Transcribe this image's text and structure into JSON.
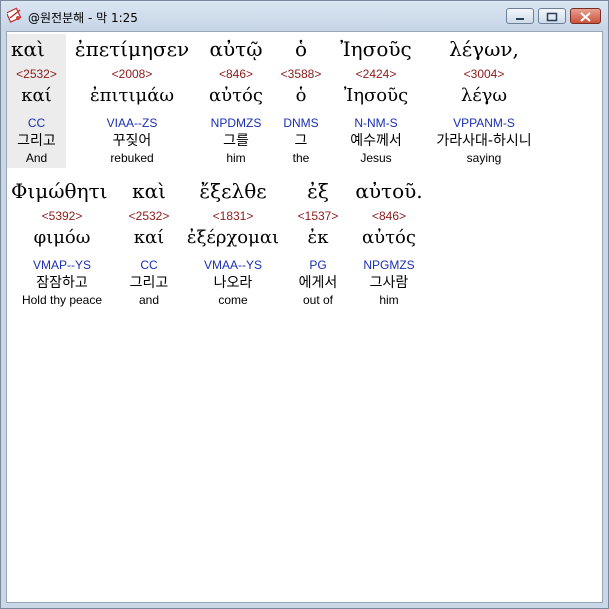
{
  "window": {
    "title": "@원전분해 - 막 1:25",
    "icon": "bible-app-icon",
    "buttons": [
      "minimize-button",
      "maximize-button",
      "close-button"
    ]
  },
  "colors": {
    "strong": "#8b1a1a",
    "parse": "#1a2fb0",
    "highlight": "#ececec"
  },
  "verse": {
    "rows": [
      {
        "words": [
          {
            "greek": "καὶ",
            "strong": "<2532>",
            "lemma": "καί",
            "parse": "CC",
            "korean": "그리고",
            "english": "And"
          },
          {
            "greek": "ἐπετίμησεν",
            "strong": "<2008>",
            "lemma": "ἐπιτιμάω",
            "parse": "VIAA--ZS",
            "korean": "꾸짖어",
            "english": "rebuked"
          },
          {
            "greek": "αὐτῷ",
            "strong": "<846>",
            "lemma": "αὐτός",
            "parse": "NPDMZS",
            "korean": "그를",
            "english": "him"
          },
          {
            "greek": "ὁ",
            "strong": "<3588>",
            "lemma": "ὁ",
            "parse": "DNMS",
            "korean": "그",
            "english": "the"
          },
          {
            "greek": "Ἰησοῦς",
            "strong": "<2424>",
            "lemma": "Ἰησοῦς",
            "parse": "N-NM-S",
            "korean": "예수께서",
            "english": "Jesus"
          },
          {
            "greek": "λέγων,",
            "strong": "<3004>",
            "lemma": "λέγω",
            "parse": "VPPANM-S",
            "korean": "가라사대-하시니",
            "english": "saying"
          }
        ]
      },
      {
        "words": [
          {
            "greek": "Φιμώθητι",
            "strong": "<5392>",
            "lemma": "φιμόω",
            "parse": "VMAP--YS",
            "korean": "잠잠하고",
            "english": "Hold thy peace"
          },
          {
            "greek": "καὶ",
            "strong": "<2532>",
            "lemma": "καί",
            "parse": "CC",
            "korean": "그리고",
            "english": "and"
          },
          {
            "greek": "ἔξελθε",
            "strong": "<1831>",
            "lemma": "ἐξέρχομαι",
            "parse": "VMAA--YS",
            "korean": "나오라",
            "english": "come"
          },
          {
            "greek": "ἐξ",
            "strong": "<1537>",
            "lemma": "ἐκ",
            "parse": "PG",
            "korean": "에게서",
            "english": "out of"
          },
          {
            "greek": "αὐτοῦ.",
            "strong": "<846>",
            "lemma": "αὐτός",
            "parse": "NPGMZS",
            "korean": "그사람",
            "english": "him"
          }
        ]
      }
    ]
  }
}
